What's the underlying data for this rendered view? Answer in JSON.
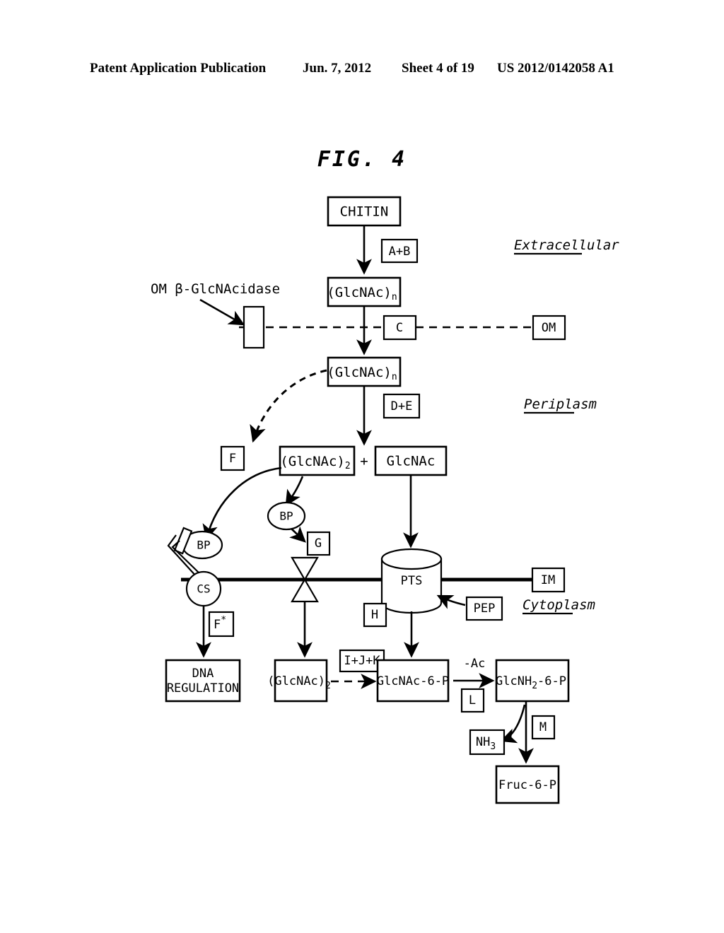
{
  "header": {
    "publication": "Patent Application Publication",
    "date": "Jun. 7, 2012",
    "sheet": "Sheet 4 of 19",
    "number": "US 2012/0142058 A1"
  },
  "figure": {
    "title": "FIG. 4",
    "compartments": [
      {
        "key": "extracellular",
        "label": "Extracellular"
      },
      {
        "key": "periplasm",
        "label": "Periplasm"
      },
      {
        "key": "cytoplasm",
        "label": "Cytoplasm"
      }
    ],
    "annotations": [
      {
        "key": "om-glcnacidase",
        "label": "OM β-GlcNAcidase"
      },
      {
        "key": "deacetyl",
        "label": "-Ac"
      },
      {
        "key": "plus-sign",
        "label": "+"
      }
    ],
    "nodes": [
      {
        "key": "chitin",
        "label": "CHITIN"
      },
      {
        "key": "glcnac-n-extracellular",
        "label": "(GlcNAc)",
        "sub": "n"
      },
      {
        "key": "glcnac-n-periplasm",
        "label": "(GlcNAc)",
        "sub": "n"
      },
      {
        "key": "glcnac-2-periplasm",
        "label": "(GlcNAc)",
        "sub": "2"
      },
      {
        "key": "glcnac-periplasm",
        "label": "GlcNAc"
      },
      {
        "key": "dna-regulation",
        "label1": "DNA",
        "label2": "REGULATION"
      },
      {
        "key": "glcnac-2-cytoplasm",
        "label": "(GlcNAc)",
        "sub": "2"
      },
      {
        "key": "glcnac-6-p",
        "label": "GlcNAc-6-P"
      },
      {
        "key": "glcnh2-6-p",
        "label": "GlcNH",
        "sub": "2",
        "label_tail": "-6-P"
      },
      {
        "key": "nh3",
        "label": "NH",
        "sub": "3"
      },
      {
        "key": "fruc-6-p",
        "label": "Fruc-6-P"
      }
    ],
    "enzymes": [
      {
        "key": "enzyme-ab",
        "label": "A+B"
      },
      {
        "key": "enzyme-c",
        "label": "C"
      },
      {
        "key": "enzyme-de",
        "label": "D+E"
      },
      {
        "key": "enzyme-f",
        "label": "F"
      },
      {
        "key": "enzyme-g",
        "label": "G"
      },
      {
        "key": "enzyme-h",
        "label": "H"
      },
      {
        "key": "enzyme-ijk",
        "label": "I+J+K"
      },
      {
        "key": "enzyme-l",
        "label": "L"
      },
      {
        "key": "enzyme-m",
        "label": "M"
      },
      {
        "key": "enzyme-f-star",
        "label": "F",
        "sup": "*"
      }
    ],
    "membranes": [
      {
        "key": "om",
        "label": "OM"
      },
      {
        "key": "im",
        "label": "IM"
      }
    ],
    "transporters": [
      {
        "key": "binding-protein-left",
        "label": "BP"
      },
      {
        "key": "binding-protein-right",
        "label": "BP"
      },
      {
        "key": "chemoreceptor",
        "label": "CS"
      },
      {
        "key": "pts-system",
        "label": "PTS"
      },
      {
        "key": "pep",
        "label": "PEP"
      }
    ]
  }
}
